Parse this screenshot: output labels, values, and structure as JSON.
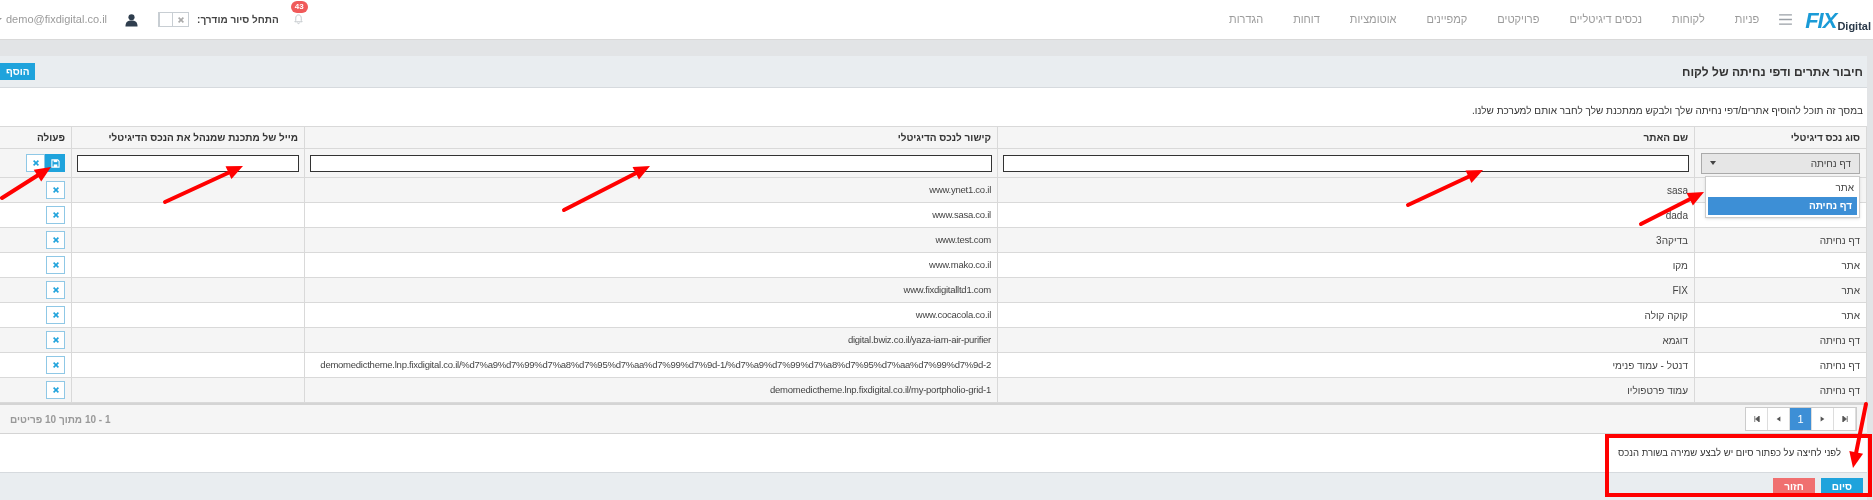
{
  "topbar": {
    "logo": {
      "mark": "FIX",
      "word": "Digital"
    },
    "nav": [
      "פניות",
      "לקוחות",
      "נכסים דיגיטליים",
      "פרויקטים",
      "קמפיינים",
      "אוטומציות",
      "דוחות",
      "הגדרות"
    ],
    "notifications_count": "43",
    "tour_label": "התחל סיור מודרך:",
    "tour_toggle": {
      "on": false
    },
    "user_email": "demo@fixdigital.co.il"
  },
  "panel": {
    "title": "חיבור אתרים ודפי נחיתה של לקוח",
    "add_button": "הוסף",
    "description": "במסך זה תוכל להוסיף אתרים/דפי נחיתה שלך ולבקש ממתכנת שלך לחבר אותם למערכת שלנו."
  },
  "table": {
    "columns": [
      "סוג נכס דיגיטלי",
      "שם האתר",
      "קישור לנכס הדיגיטלי",
      "מייל של מתכנת שמנהל את הנכס הדיגיטלי",
      "פעולה"
    ],
    "filter": {
      "type_select": {
        "value": "דף נחיתה",
        "expanded": true,
        "options": [
          {
            "label": "אתר",
            "selected": false
          },
          {
            "label": "דף נחיתה",
            "selected": true
          }
        ]
      }
    },
    "rows": [
      {
        "name": "sasa",
        "link": "www.ynet1.co.il"
      },
      {
        "name": "dada",
        "link": "www.sasa.co.il"
      },
      {
        "type": "דף נחיתה",
        "name": "בדיקה3",
        "link": "www.test.com"
      },
      {
        "type": "אתר",
        "name": "מקו",
        "link": "www.mako.co.il"
      },
      {
        "type": "אתר",
        "name": "FIX",
        "link": "www.fixdigitalltd1.com"
      },
      {
        "type": "אתר",
        "name": "קוקה קולה",
        "link": "www.cocacola.co.il"
      },
      {
        "type": "דף נחיתה",
        "name": "דוגמא",
        "link": "digital.bwiz.co.il/yaza-iam-air-purifier"
      },
      {
        "type": "דף נחיתה",
        "name": "דנטל - עמוד פנימי",
        "link": "demomedictheme.lnp.fixdigital.co.il/%d7%a9%d7%99%d7%a8%d7%95%d7%aa%d7%99%d7%9d-1/%d7%a9%d7%99%d7%a8%d7%95%d7%aa%d7%99%d7%9d-2"
      },
      {
        "type": "דף נחיתה",
        "name": "עמוד פרטפוליו",
        "link": "demomedictheme.lnp.fixdigital.co.il/my-portpholio-grid-1"
      }
    ],
    "pager": {
      "pages": [
        {
          "label": "1",
          "selected": true
        }
      ],
      "summary": "1 - 10 מתוך 10 פריטים"
    }
  },
  "footer": {
    "note": "לפני לחיצה על כפתור סיום יש לבצע שמירה בשורת הנכס",
    "buttons": [
      {
        "label": "סיום",
        "kind": "primary"
      },
      {
        "label": "חזור",
        "kind": "danger"
      }
    ]
  }
}
